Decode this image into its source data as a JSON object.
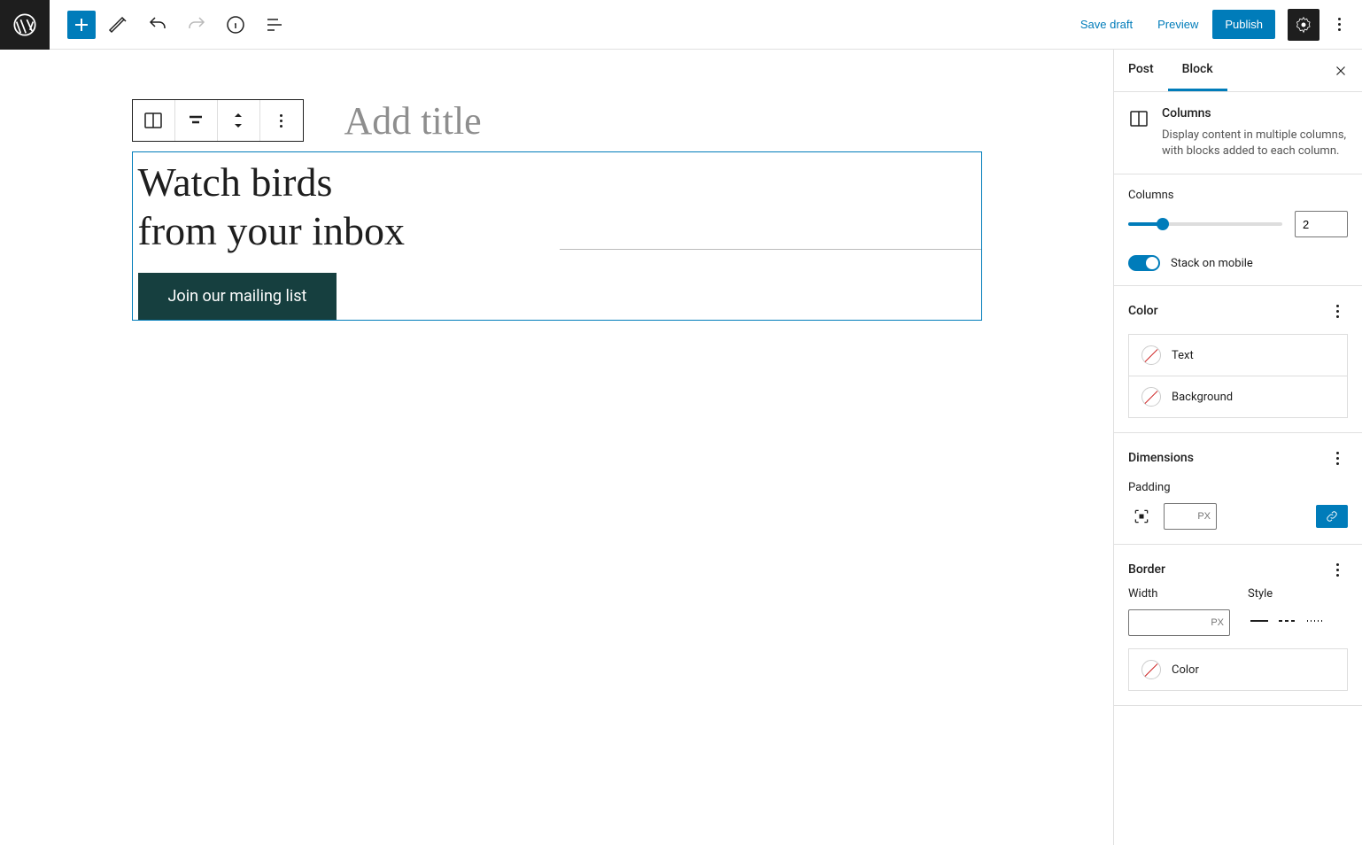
{
  "topbar": {
    "save_draft": "Save draft",
    "preview": "Preview",
    "publish": "Publish"
  },
  "editor": {
    "title_placeholder": "Add title",
    "heading_line1": "Watch birds",
    "heading_line2": "from your inbox",
    "button_label": "Join our mailing list"
  },
  "sidebar": {
    "tab_post": "Post",
    "tab_block": "Block",
    "block_info": {
      "title": "Columns",
      "desc": "Display content in multiple columns, with blocks added to each column."
    },
    "columns": {
      "label": "Columns",
      "value": "2",
      "stack_label": "Stack on mobile"
    },
    "color": {
      "title": "Color",
      "text": "Text",
      "background": "Background",
      "color_label": "Color"
    },
    "dimensions": {
      "title": "Dimensions",
      "padding": "Padding",
      "unit": "PX"
    },
    "border": {
      "title": "Border",
      "width": "Width",
      "style": "Style",
      "unit": "PX"
    }
  }
}
